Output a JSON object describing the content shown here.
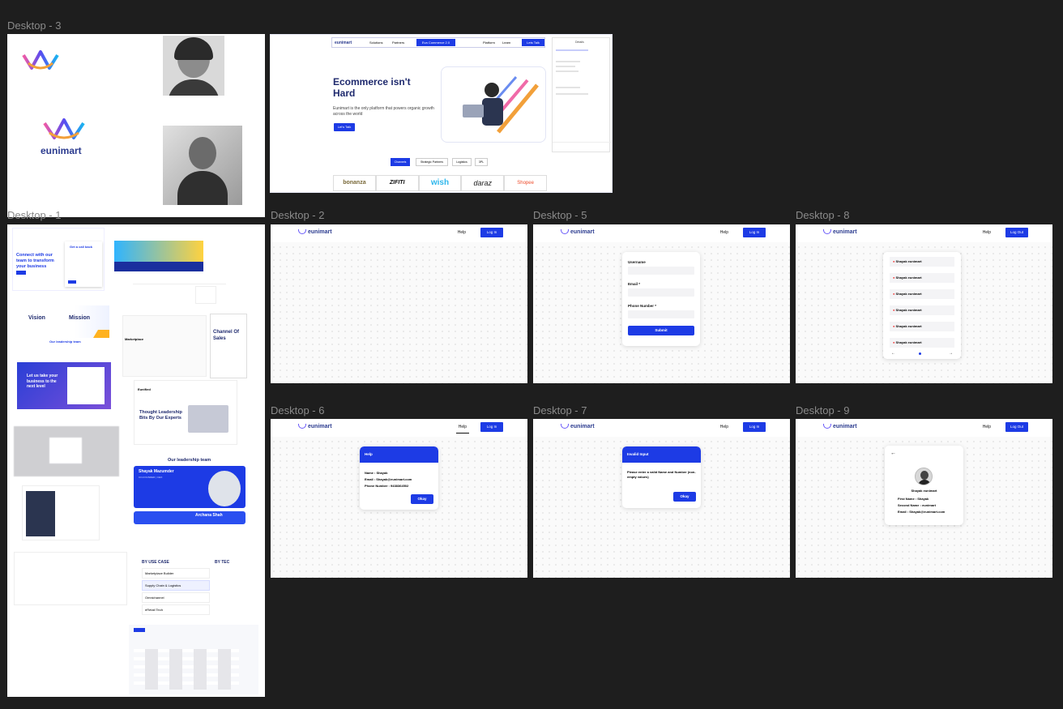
{
  "frames": {
    "desktop3": "Desktop - 3",
    "desktop1": "Desktop - 1",
    "desktop2": "Desktop - 2",
    "desktop5": "Desktop - 5",
    "desktop8": "Desktop - 8",
    "desktop6": "Desktop - 6",
    "desktop7": "Desktop - 7",
    "desktop9": "Desktop - 9"
  },
  "brand": "eunimart",
  "nav": {
    "help": "Help",
    "login": "Log In",
    "logout": "Log Out"
  },
  "hero": {
    "title": "Ecommerce isn't Hard",
    "subtitle": "Eunimart is the only platform that powers organic growth across the world",
    "cta": "Let's Talk",
    "menu": [
      "Solutions",
      "Partners",
      "Eva Commerce 2.0",
      "Platform",
      "Learn",
      "Lets Talk"
    ],
    "tabs": [
      "Channels",
      "Strategic Partners",
      "Logistics",
      "3PL"
    ],
    "marketplaces": [
      "bonanza",
      "ZIFITI",
      "wish",
      "daraz",
      "Shopee"
    ],
    "sidepanel_title": "Details"
  },
  "desktop1": {
    "connect_heading": "Connect with our team to transform your business",
    "call_back": "Get a call back",
    "vision": "Vision",
    "mission": "Mission",
    "leadership_small": "Our leadership team",
    "business_next": "Let us take your business to the next level",
    "thought": "Thought Leadership Bits By Our Experts",
    "eunified": "Eunified",
    "marketplace": "Marketplace",
    "channel_of_sales": "Channel Of Sales",
    "leadership_team": "Our leadership team",
    "person1": "Shayak Mazumder",
    "person1_role": "CO-FOUNDER | CEO",
    "person2": "Archana Shah",
    "by_use_case": "BY USE CASE",
    "by_tech": "BY TEC",
    "use_cases": [
      "Marketplace Builder",
      "Supply Chain & Logistics",
      "Omnichannel",
      "eRetail Tech"
    ]
  },
  "form": {
    "username": "Username",
    "email": "Email *",
    "phone": "Phone Number *",
    "submit": "Submit"
  },
  "list": {
    "items": [
      "Shayak eunimart",
      "Shayak eunimart",
      "Shayak eunimart",
      "Shayak eunimart",
      "Shayak eunimart",
      "Shayak eunimart"
    ]
  },
  "help_modal": {
    "title": "Help",
    "name": "Name : Shayak",
    "email": "Email : Shayak@eunimart.com",
    "phone": "Phone Number : 9438364502",
    "ok": "Okay"
  },
  "invalid_modal": {
    "title": "Invalid Input",
    "message": "Please enter a valid Name and Number (non-empty values)",
    "ok": "Okay"
  },
  "profile": {
    "name": "Shayak eunimart",
    "first": "First Name : Shayak",
    "second": "Second Name : eunimart",
    "email": "Email : Shayak@eunimart.com"
  },
  "colors": {
    "accent": "#1d3be5",
    "canvas": "#1e1e1e",
    "label": "#8a8a8a"
  }
}
